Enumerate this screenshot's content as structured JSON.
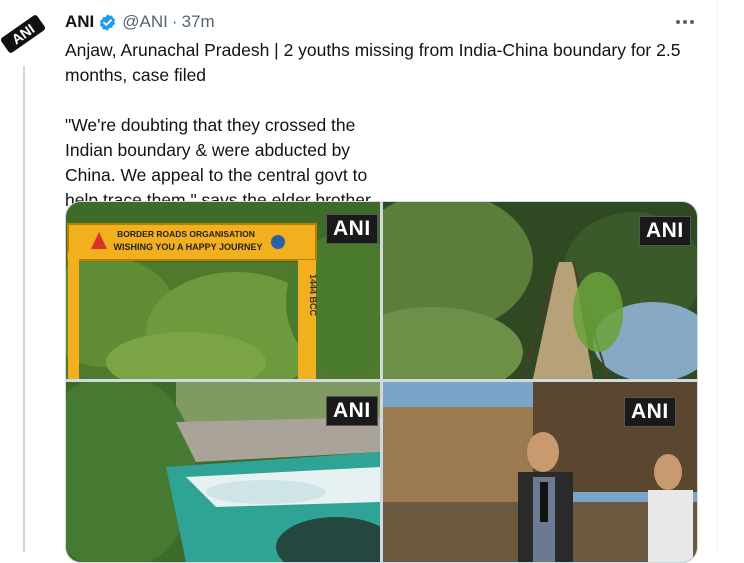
{
  "tweet": {
    "author_name": "ANI",
    "handle": "@ANI",
    "separator": "·",
    "time": "37m",
    "paragraph_1": "Anjaw, Arunachal Pradesh | 2 youths missing from India-China boundary for 2.5 months, case filed",
    "paragraph_2": "\"We're doubting that they crossed the Indian boundary & were abducted by China. We appeal to the central govt to help trace them,\" says the elder brother of one of the missing youths"
  },
  "avatar": {
    "logo_text": "ANI"
  },
  "photos": [
    {
      "watermark": "ANI",
      "sign_line_1": "BORDER ROADS ORGANISATION",
      "sign_line_2": "WISHING YOU A HAPPY JOURNEY",
      "post_text": "1444 BCC"
    },
    {
      "watermark": "ANI"
    },
    {
      "watermark": "ANI"
    },
    {
      "watermark": "ANI"
    }
  ],
  "colors": {
    "verified_blue": "#1d9bf0",
    "secondary_text": "#536471",
    "sign_yellow": "#f2b01e"
  },
  "icons": {
    "verified": "verified-badge-icon",
    "more": "more-horizontal-icon"
  }
}
